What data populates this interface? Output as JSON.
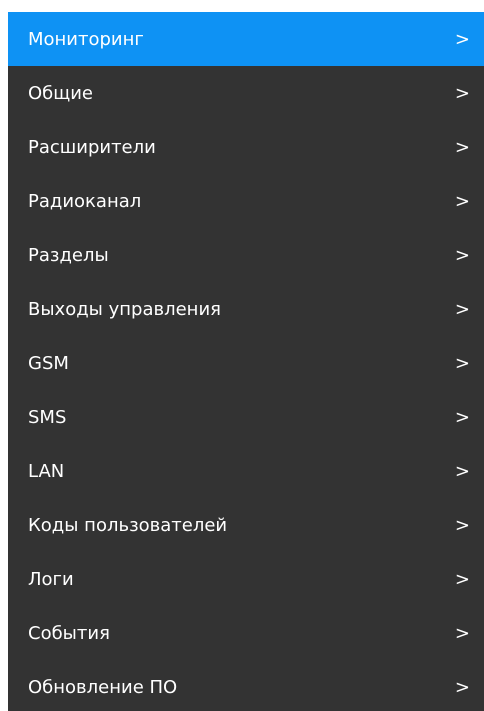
{
  "menu": {
    "items": [
      {
        "label": "Мониторинг",
        "arrow": ">",
        "active": true
      },
      {
        "label": "Общие",
        "arrow": ">"
      },
      {
        "label": "Расширители",
        "arrow": ">"
      },
      {
        "label": "Радиоканал",
        "arrow": ">"
      },
      {
        "label": "Разделы",
        "arrow": ">"
      },
      {
        "label": "Выходы управления",
        "arrow": ">"
      },
      {
        "label": "GSM",
        "arrow": ">"
      },
      {
        "label": "SMS",
        "arrow": ">"
      },
      {
        "label": "LAN",
        "arrow": ">"
      },
      {
        "label": "Коды пользователей",
        "arrow": ">"
      },
      {
        "label": "Логи",
        "arrow": ">"
      },
      {
        "label": "События",
        "arrow": ">"
      },
      {
        "label": "Обновление ПО",
        "arrow": ">"
      }
    ]
  },
  "colors": {
    "menu_background": "#333333",
    "active_background": "#0e92f4",
    "text": "#ffffff"
  }
}
